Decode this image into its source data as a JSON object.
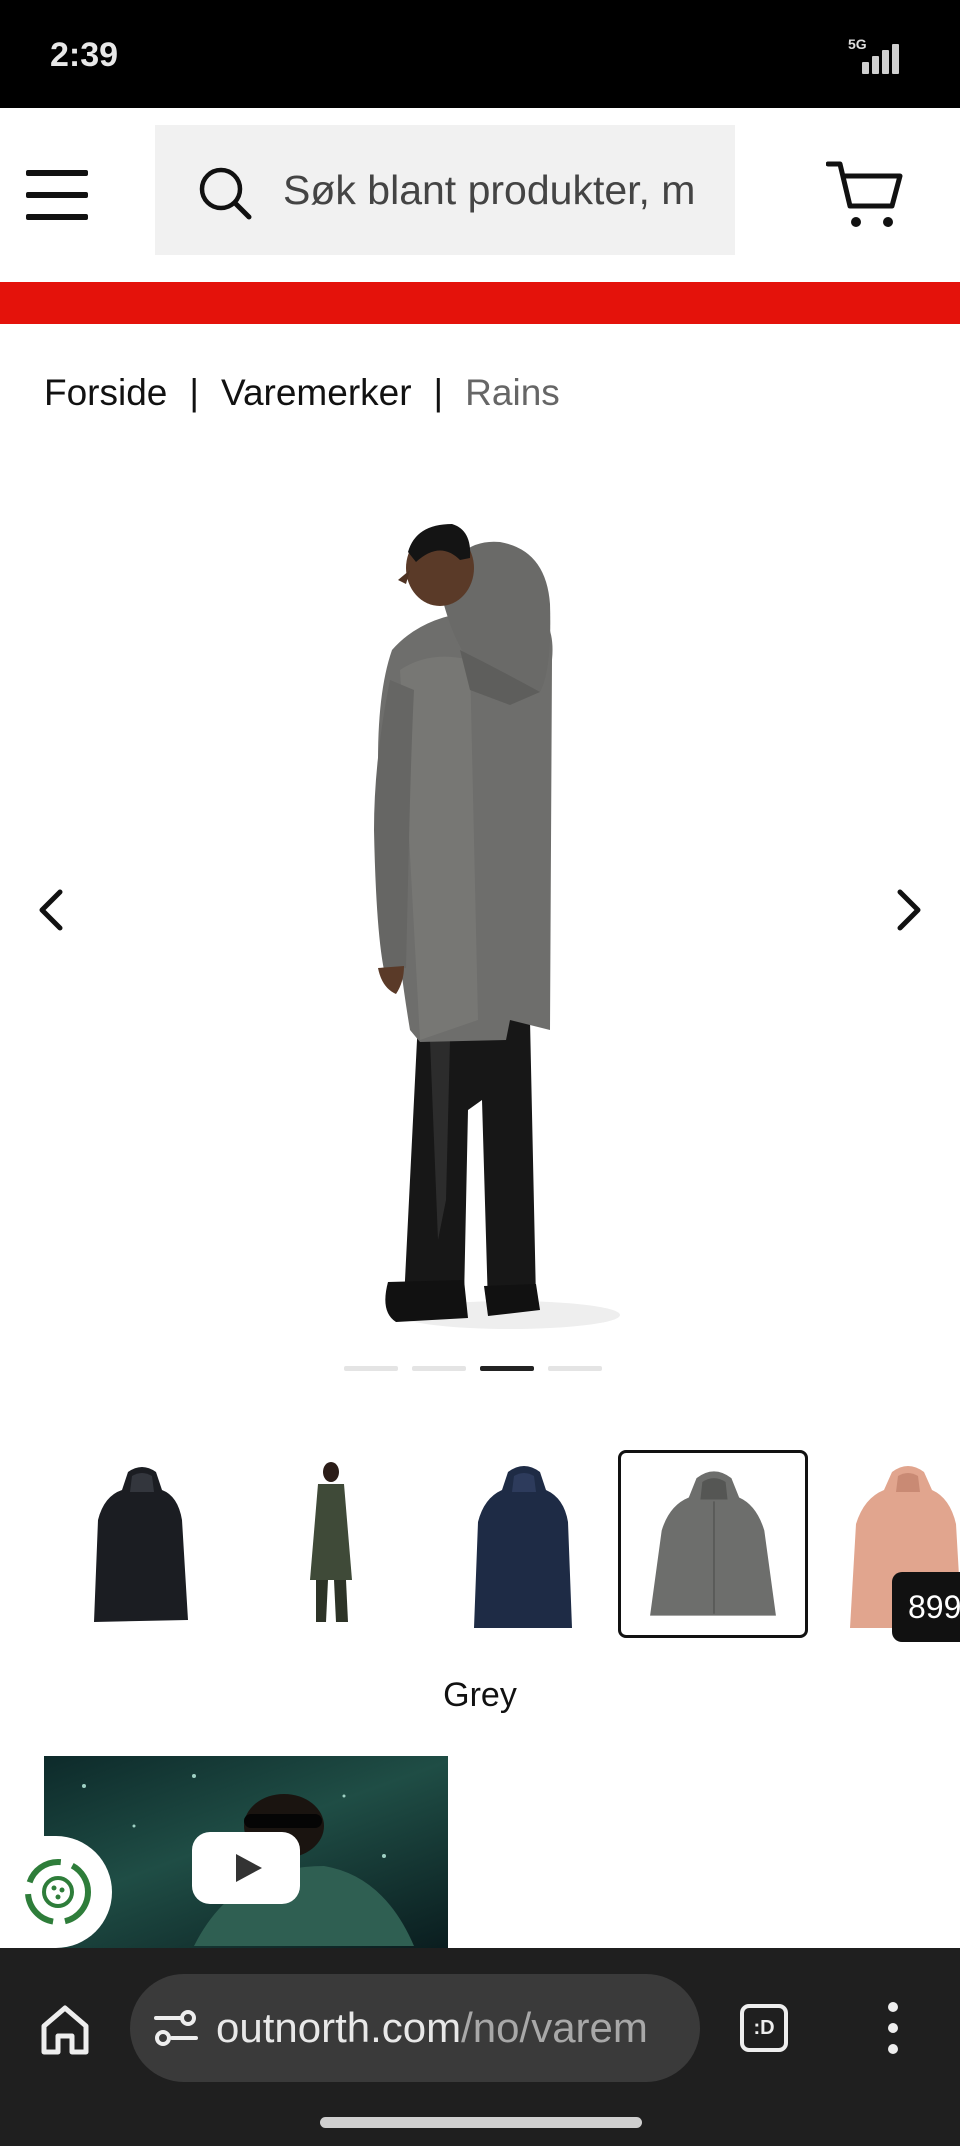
{
  "status_bar": {
    "time": "2:39",
    "network": "5G"
  },
  "header": {
    "search": {
      "placeholder": "Søk blant produkter, m"
    }
  },
  "breadcrumb": {
    "items": [
      "Forside",
      "Varemerker",
      "Rains"
    ],
    "separator": "|"
  },
  "gallery": {
    "slides_total": 4,
    "active_slide": 3
  },
  "variants": {
    "selected_color": "Grey",
    "thumbs": [
      {
        "color": "Black"
      },
      {
        "color": "Green"
      },
      {
        "color": "Navy"
      },
      {
        "color": "Grey",
        "selected": true
      },
      {
        "color": "Rose"
      }
    ],
    "price_badge": "899"
  },
  "browser": {
    "url_domain": "outnorth.com",
    "url_path": "/no/varem",
    "tabs_label": ":D"
  },
  "colors": {
    "accent_red": "#e4120b",
    "browser_bar": "#1f1f1f",
    "url_pill": "#3a3a3a"
  }
}
